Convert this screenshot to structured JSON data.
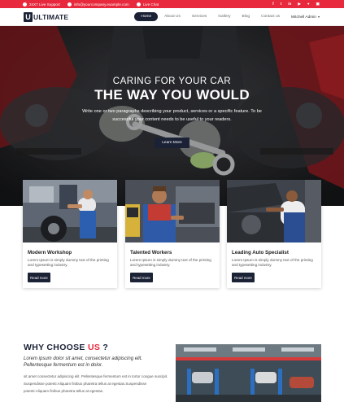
{
  "topbar": {
    "support": "24X7 Live Support",
    "email": "info@yourcompany.example.com",
    "chat": "Live Chat",
    "social_icons": [
      "facebook-icon",
      "twitter-icon",
      "linkedin-icon",
      "youtube-icon",
      "github-icon",
      "instagram-icon"
    ],
    "social_glyphs": [
      "f",
      "t",
      "in",
      "▶",
      "●",
      "▣"
    ]
  },
  "nav": {
    "logo_mark": "U",
    "logo_text": "ULTIMATE",
    "items": [
      "Home",
      "About Us",
      "Services",
      "Gallery",
      "Blog",
      "Contact us"
    ],
    "active_index": 0,
    "user": "Mitchell Admin",
    "user_caret": "▾"
  },
  "hero": {
    "subtitle": "CARING FOR YOUR CAR",
    "title": "THE WAY YOU WOULD",
    "description": "Write one or two paragraphs describing your product, services or a specific feature. To be successful your content needs to be useful to your readers.",
    "button": "Learn More"
  },
  "cards": [
    {
      "title": "Modern Workshop",
      "text": "Lorem Ipsum is simply dummy text of the printing and typesetting industry.",
      "button": "Read more"
    },
    {
      "title": "Talented Workers",
      "text": "Lorem Ipsum is simply dummy text of the printing and typesetting industry.",
      "button": "Read more"
    },
    {
      "title": "Leading Auto Specialist",
      "text": "Lorem Ipsum is simply dummy text of the printing and typesetting industry.",
      "button": "Read more"
    }
  ],
  "why": {
    "title_prefix": "WHY CHOOSE ",
    "title_highlight": "US",
    "title_suffix": " ?",
    "lead": "Lorem ipsum dolor sit amet, consectetur adipiscing elit. Pellentesque fermentum est in dolor.",
    "body": "sit amet consectetur adipiscing elit. Pellentesque fermentum est in tortor congue suscipit. Suspendisse potenti.Aliquam finibus pharetra tellus at egestas.Suspendisse potenti.Aliquam finibus pharetra tellus at egestas."
  },
  "colors": {
    "accent": "#e8283c",
    "navy": "#1b2236"
  }
}
